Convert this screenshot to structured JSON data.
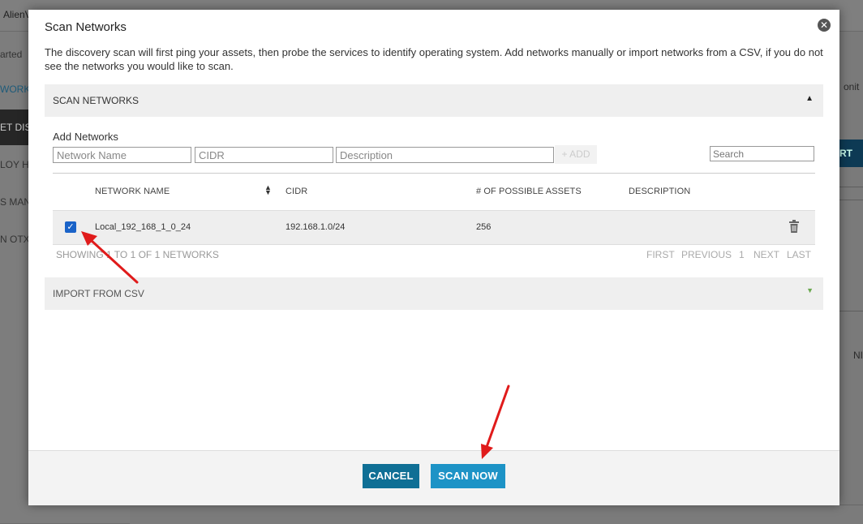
{
  "background": {
    "brand": "AlienV",
    "sidebar_items": [
      "arted",
      "WORK",
      "ET DIS",
      "LOY H",
      "S MANA",
      "N OTX"
    ],
    "right_text_1": "onit",
    "right_button": "RT FR",
    "right_text_2": "NI"
  },
  "modal": {
    "title": "Scan Networks",
    "intro": "The discovery scan will first ping your assets, then probe the services to identify operating system. Add networks manually or import networks from a CSV, if you do not see the networks you would like to scan.",
    "scan_section": {
      "label": "SCAN NETWORKS",
      "caret": "▲"
    },
    "add_networks": {
      "label": "Add Networks",
      "network_name_placeholder": "Network Name",
      "cidr_placeholder": "CIDR",
      "description_placeholder": "Description",
      "add_button": "+ ADD",
      "search_placeholder": "Search"
    },
    "table": {
      "columns": [
        "NETWORK NAME",
        "CIDR",
        "# OF POSSIBLE ASSETS",
        "DESCRIPTION"
      ],
      "rows": [
        {
          "checked": true,
          "name": "Local_192_168_1_0_24",
          "cidr": "192.168.1.0/24",
          "assets": "256",
          "description": ""
        }
      ]
    },
    "showing": "SHOWING 1 TO 1 OF 1 NETWORKS",
    "pager": {
      "first": "FIRST",
      "previous": "PREVIOUS",
      "page": "1",
      "next": "NEXT",
      "last": "LAST"
    },
    "import_section": {
      "label": "IMPORT FROM CSV",
      "caret": "▼"
    },
    "buttons": {
      "cancel": "CANCEL",
      "scan_now": "SCAN NOW"
    },
    "colors": {
      "cancel": "#0f6f95",
      "scan_now": "#1d93c6",
      "checkbox": "#1a63c8",
      "arrow": "#e01b1b"
    }
  }
}
